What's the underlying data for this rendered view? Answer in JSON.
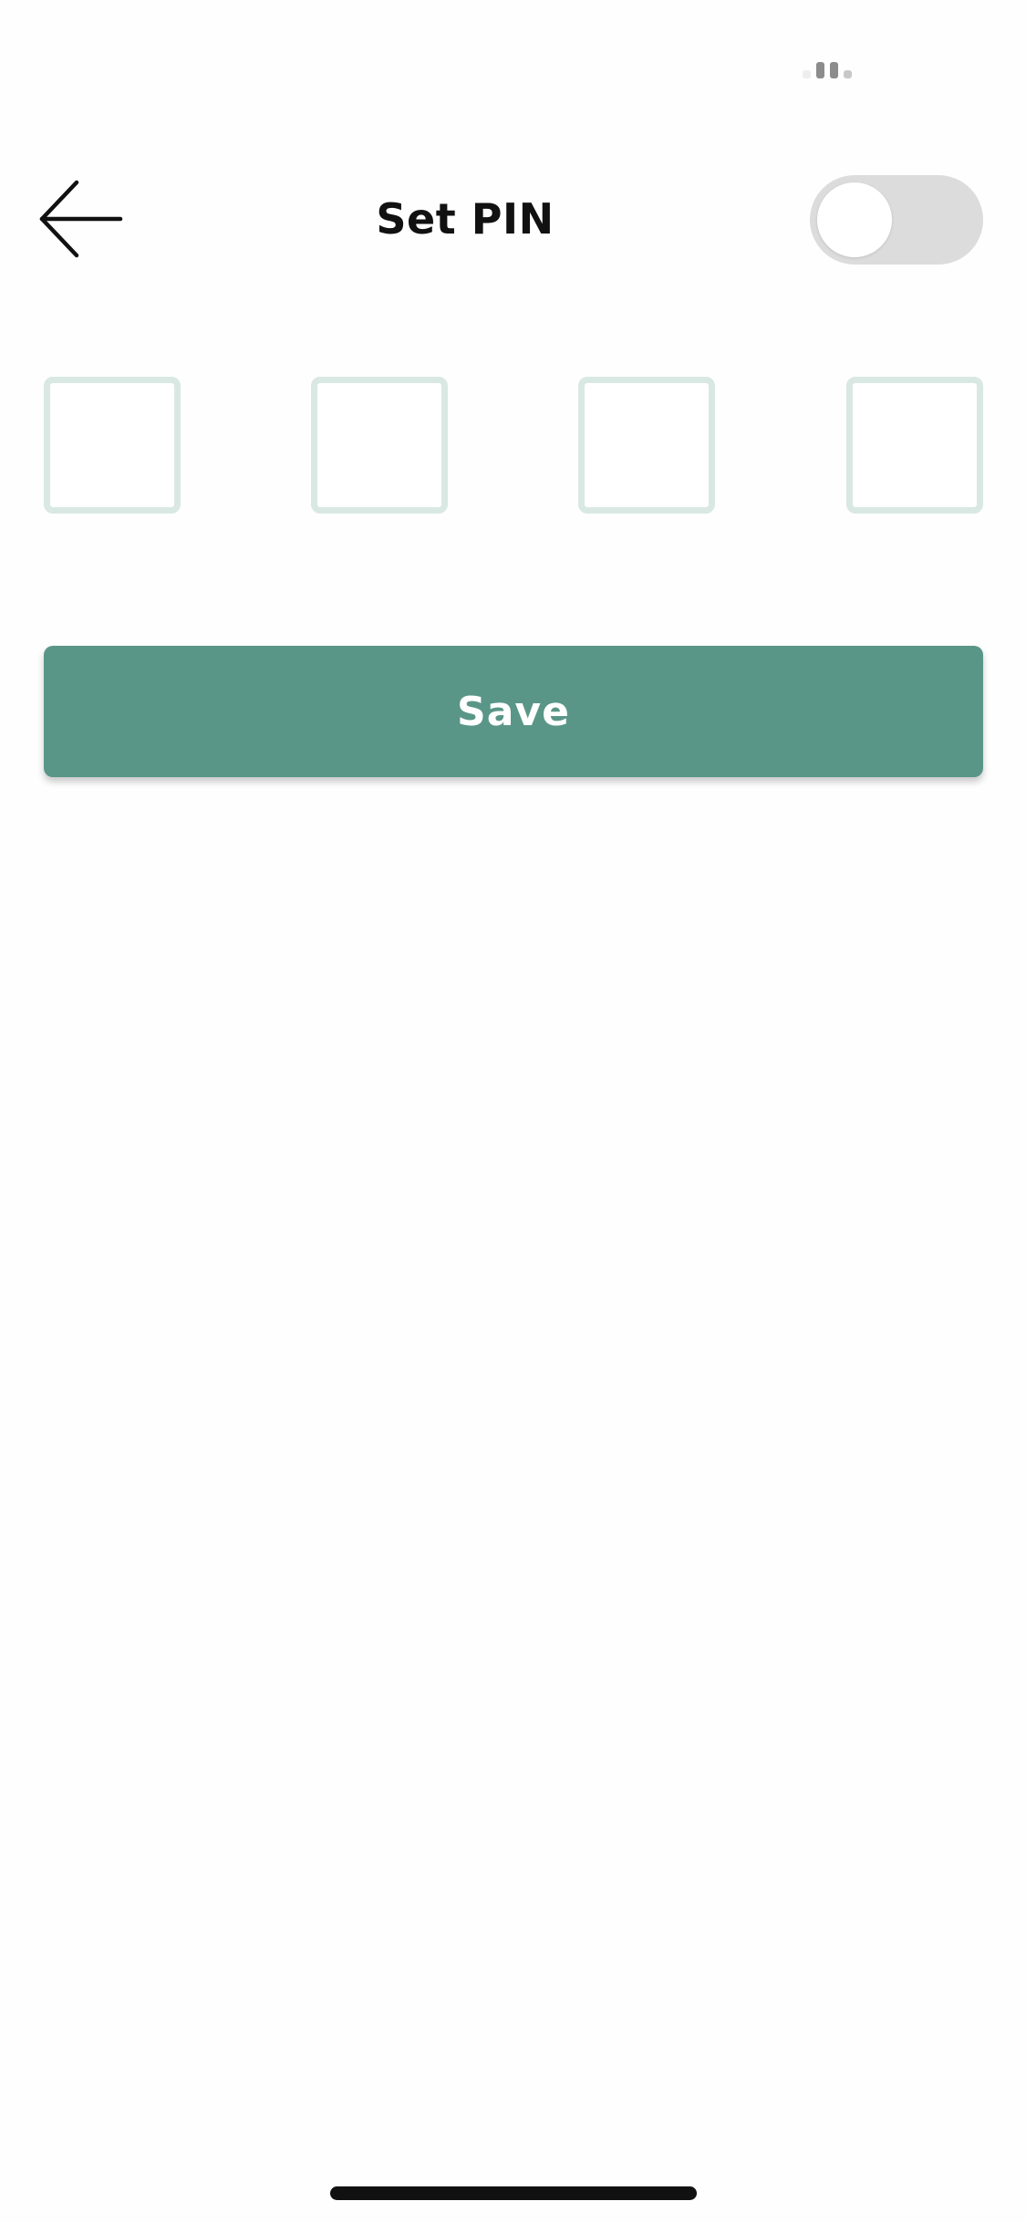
{
  "header": {
    "title": "Set PIN",
    "back_icon": "arrow-left-icon",
    "pin_toggle": {
      "state": "off"
    }
  },
  "pin": {
    "length": 4,
    "digits": [
      "",
      "",
      "",
      ""
    ],
    "border_color": "#d9e8e3"
  },
  "actions": {
    "save_label": "Save",
    "save_color": "#5a9688"
  }
}
